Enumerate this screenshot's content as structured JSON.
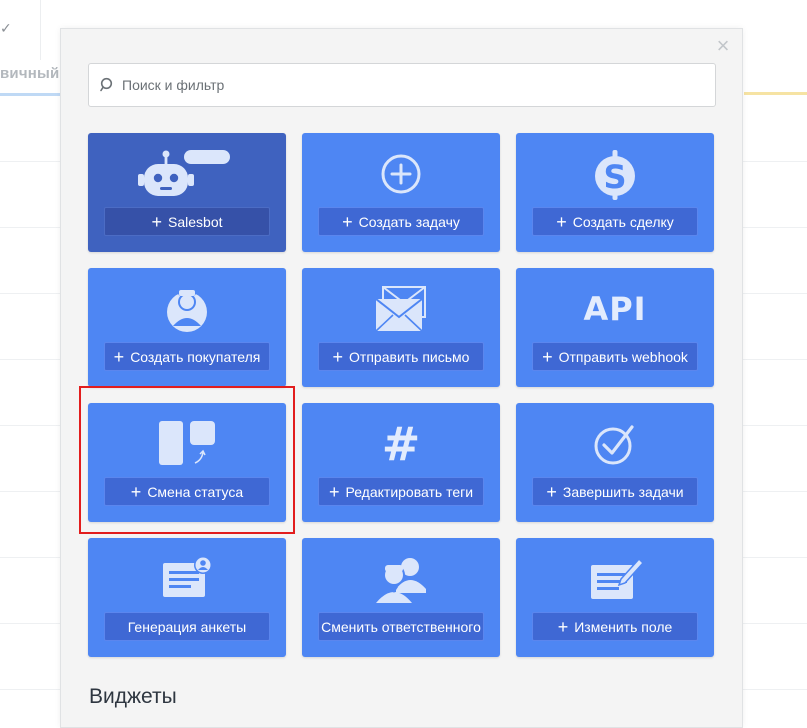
{
  "background": {
    "tab_label": "вичный к",
    "check_icon": "checkmark-icon"
  },
  "modal": {
    "close_icon": "close-icon",
    "search": {
      "placeholder": "Поиск и фильтр",
      "value": "",
      "icon": "search-icon"
    },
    "actions": [
      {
        "label": "Salesbot",
        "icon": "robot-icon",
        "has_plus": true,
        "style": "dark"
      },
      {
        "label": "Создать задачу",
        "icon": "plus-circle-icon",
        "has_plus": true
      },
      {
        "label": "Создать сделку",
        "icon": "dollar-icon",
        "has_plus": true
      },
      {
        "label": "Создать покупателя",
        "icon": "customer-icon",
        "has_plus": true
      },
      {
        "label": "Отправить письмо",
        "icon": "envelope-icon",
        "has_plus": true
      },
      {
        "label": "Отправить webhook",
        "icon": "api-icon",
        "icon_text": "API",
        "has_plus": true
      },
      {
        "label": "Смена статуса",
        "icon": "status-change-icon",
        "has_plus": true,
        "highlighted": true
      },
      {
        "label": "Редактировать теги",
        "icon": "hashtag-icon",
        "has_plus": true
      },
      {
        "label": "Завершить задачи",
        "icon": "check-circle-icon",
        "has_plus": true
      },
      {
        "label": "Генерация анкеты",
        "icon": "form-profile-icon",
        "has_plus": false
      },
      {
        "label": "Сменить ответственного",
        "icon": "users-swap-icon",
        "has_plus": false
      },
      {
        "label": "Изменить поле",
        "icon": "edit-field-icon",
        "has_plus": true
      }
    ],
    "widgets_title": "Виджеты"
  },
  "colors": {
    "card": "#4e86f3",
    "card_dark": "#3f62bf",
    "highlight": "#e21d1d"
  }
}
